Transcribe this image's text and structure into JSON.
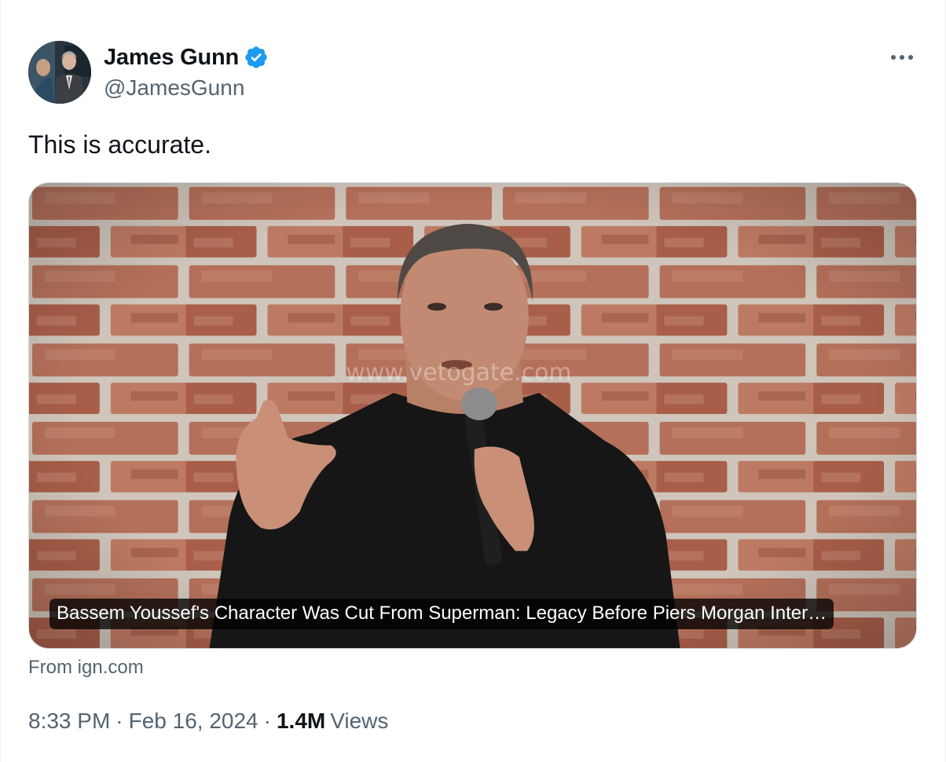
{
  "author": {
    "display_name": "James Gunn",
    "handle": "@JamesGunn",
    "verified_icon": "verified-badge-icon",
    "avatar_icon": "profile-photo"
  },
  "menu": {
    "icon": "more-options-icon"
  },
  "tweet": {
    "text": "This is accurate."
  },
  "card": {
    "title": "Bassem Youssef's Character Was Cut From Superman: Legacy Before Piers Morgan Inter…",
    "source": "From ign.com",
    "image": "man-speaking-into-microphone-brick-wall",
    "watermark": "www.vetogate.com"
  },
  "meta": {
    "time": "8:33 PM",
    "separator": "·",
    "date": "Feb 16, 2024",
    "views_count": "1.4M",
    "views_label": "Views"
  },
  "colors": {
    "text_primary": "#0f1419",
    "text_secondary": "#536471",
    "verified_blue": "#1d9bf0",
    "card_border": "#cfd9de"
  }
}
